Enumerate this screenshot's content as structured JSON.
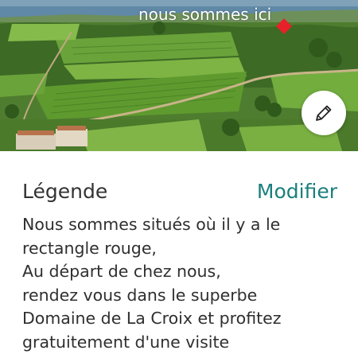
{
  "photo": {
    "overlay_label": "nous sommes ici",
    "marker_color": "#e8202a",
    "edit_icon": "pencil-icon"
  },
  "legend": {
    "title": "Légende",
    "modify_label": "Modifier",
    "accent_color": "#1a7f7d",
    "lines": [
      "Nous sommes situés où il y a le",
      "rectangle rouge,",
      "Au départ de chez nous,",
      "rendez vous dans le superbe",
      "Domaine de La Croix et profitez",
      "gratuitement d'une visite"
    ]
  }
}
